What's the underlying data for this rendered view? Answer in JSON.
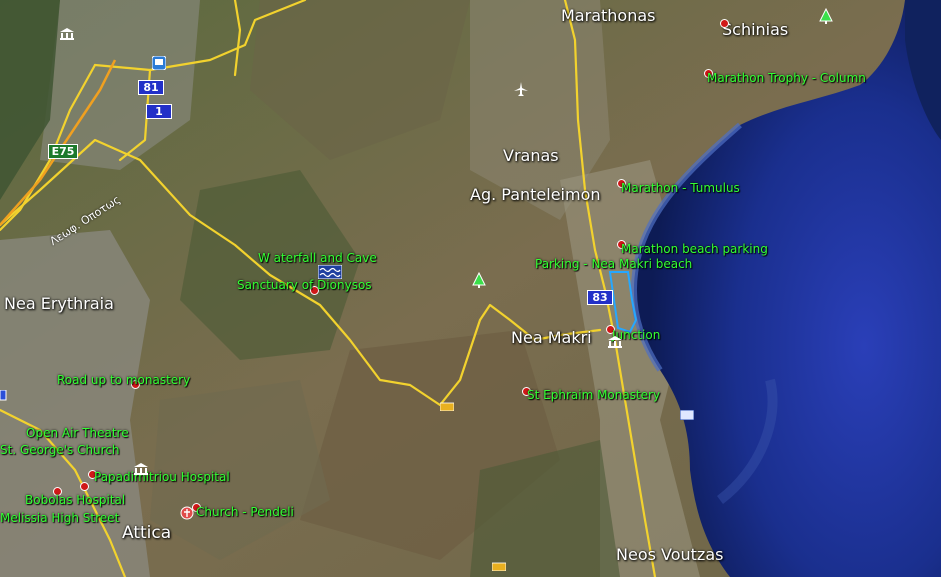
{
  "map": {
    "region": "Attica",
    "places": {
      "marathonas": "Marathonas",
      "schinias": "Schinias",
      "vranas": "Vranas",
      "ag_panteleimon": "Ag. Panteleimon",
      "nea_erythraia": "Nea Erythraia",
      "nea_makri": "Nea Makri",
      "neos_voutzas": "Neos Voutzas",
      "attica": "Attica"
    },
    "pois": {
      "marathon_trophy": "Marathon Trophy - Column",
      "marathon_tumulus": "Marathon - Tumulus",
      "marathon_beach_parking": "Marathon beach parking",
      "parking_nea_makri": "Parking - Nea Makri beach",
      "junction": "Junction",
      "st_ephraim": "St Ephraim Monastery",
      "waterfall_cave": "W aterfall and Cave",
      "sanctuary_dionysos": "Sanctuary of Dionysos",
      "road_up_monastery": "Road up to monastery",
      "open_air_theatre": "Open Air Theatre",
      "st_georges_church": "St. George's Church",
      "papadimitriou_hospital": "Papadimitriou Hospital",
      "bobolas_hospital": "Bobolas Hospital",
      "melissia_high_street": "Melissia High Street",
      "church_pendeli": "Church - Pendeli"
    },
    "road_shields": {
      "s81": "81",
      "s1": "1",
      "e75": "E75",
      "s83": "83"
    },
    "road_name": "Λεωφ. Οποτως",
    "colors": {
      "road_yellow": "#f2d22e",
      "poi_label": "#33ff33",
      "place_label": "#ffffff",
      "sea": "#1a2f8e",
      "route_outline": "#26a7ff",
      "pin_red": "#d01818"
    }
  }
}
